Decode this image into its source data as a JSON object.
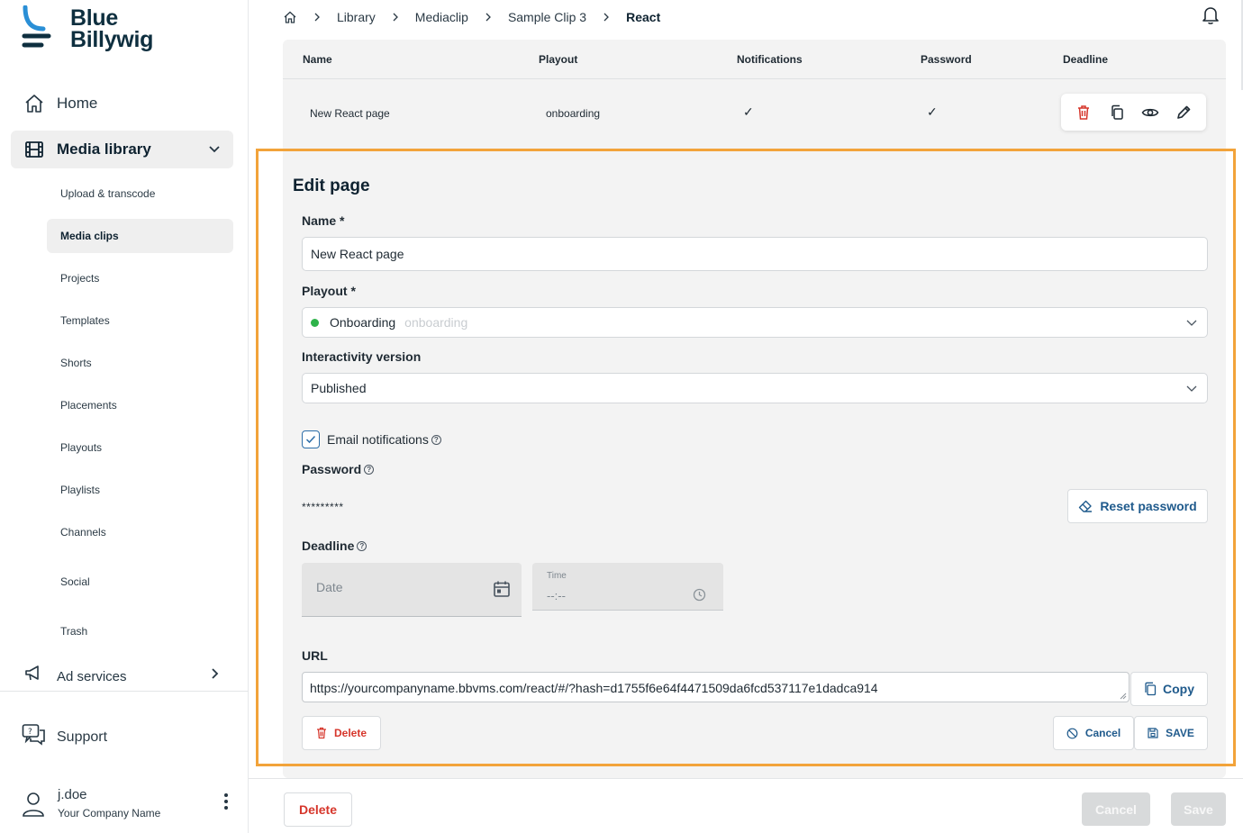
{
  "brand": {
    "line1": "Blue",
    "line2": "Billywig"
  },
  "sidebar": {
    "main_items": [
      {
        "label": "Home",
        "icon": "home-icon"
      },
      {
        "label": "Media library",
        "icon": "film-icon",
        "expanded": true
      },
      {
        "label": "Ad services",
        "icon": "megaphone-icon"
      }
    ],
    "sub_items": [
      {
        "label": "Upload & transcode"
      },
      {
        "label": "Media clips",
        "active": true
      },
      {
        "label": "Projects"
      },
      {
        "label": "Templates"
      },
      {
        "label": "Shorts"
      },
      {
        "label": "Placements"
      },
      {
        "label": "Playouts"
      },
      {
        "label": "Playlists"
      },
      {
        "label": "Channels"
      },
      {
        "label": "Social"
      },
      {
        "label": "Trash"
      }
    ],
    "support": "Support",
    "user": {
      "name": "j.doe",
      "company": "Your Company Name"
    }
  },
  "breadcrumb": [
    "Library",
    "Mediaclip",
    "Sample Clip 3",
    "React"
  ],
  "table": {
    "headers": [
      "Name",
      "Playout",
      "Notifications",
      "Password",
      "Deadline"
    ],
    "row": {
      "name": "New React page",
      "playout": "onboarding",
      "notifications": "✓",
      "password": "✓",
      "deadline": ""
    }
  },
  "edit": {
    "title": "Edit page",
    "name_label": "Name *",
    "name_value": "New React page",
    "playout_label": "Playout *",
    "playout_value": "Onboarding",
    "playout_hint": "onboarding",
    "interactivity_label": "Interactivity version",
    "interactivity_value": "Published",
    "email_notifications_label": "Email notifications",
    "email_notifications_checked": true,
    "password_label": "Password",
    "password_mask": "*********",
    "reset_password_label": "Reset password",
    "deadline_label": "Deadline",
    "date_placeholder": "Date",
    "time_caption": "Time",
    "time_placeholder": "--:--",
    "url_label": "URL",
    "url_value": "https://yourcompanyname.bbvms.com/react/#/?hash=d1755f6e64f4471509da6fcd537117e1dadca914",
    "copy_label": "Copy",
    "delete_label": "Delete",
    "cancel_label": "Cancel",
    "save_label": "SAVE"
  },
  "footer": {
    "delete_label": "Delete",
    "cancel_label": "Cancel",
    "save_label": "Save"
  },
  "colors": {
    "accent": "#1f5a8c",
    "danger": "#d6362b",
    "highlight": "#f2a33a",
    "status_green": "#2eb34a"
  }
}
